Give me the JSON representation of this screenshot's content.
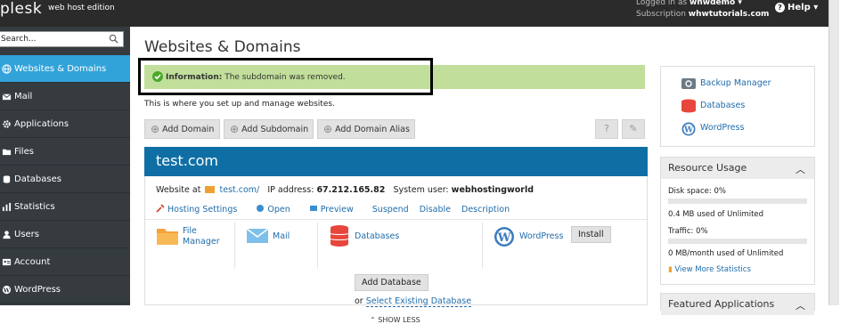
{
  "header": {
    "logo": "plesk",
    "edition": "web host edition",
    "logged_in_label": "Logged in as",
    "logged_in_user": "whwdemo",
    "subscription_label": "Subscription",
    "subscription_value": "whwtutorials.com",
    "help_label": "Help"
  },
  "sidebar": {
    "search_placeholder": "Search...",
    "items": [
      {
        "label": "Websites & Domains",
        "icon": "globe-icon",
        "active": true
      },
      {
        "label": "Mail",
        "icon": "mail-icon"
      },
      {
        "label": "Applications",
        "icon": "gear-icon"
      },
      {
        "label": "Files",
        "icon": "folder-icon"
      },
      {
        "label": "Databases",
        "icon": "database-icon"
      },
      {
        "label": "Statistics",
        "icon": "chart-icon"
      },
      {
        "label": "Users",
        "icon": "user-icon"
      },
      {
        "label": "Account",
        "icon": "account-icon"
      },
      {
        "label": "WordPress",
        "icon": "wordpress-icon"
      }
    ]
  },
  "main": {
    "title": "Websites & Domains",
    "info_label": "Information:",
    "info_text": "The subdomain was removed.",
    "intro": "This is where you set up and manage websites.",
    "toolbar": {
      "add_domain": "Add Domain",
      "add_subdomain": "Add Subdomain",
      "add_alias": "Add Domain Alias",
      "help": "?",
      "tools": "tools"
    },
    "domain": {
      "name": "test.com",
      "website_at": "Website at",
      "site_link": "test.com/",
      "ip_label": "IP address:",
      "ip": "67.212.165.82",
      "sysuser_label": "System user:",
      "sysuser": "webhostingworld",
      "actions": [
        "Hosting Settings",
        "Open",
        "Preview",
        "Suspend",
        "Disable",
        "Description"
      ],
      "file_manager_1": "File",
      "file_manager_2": "Manager",
      "mail": "Mail",
      "databases": "Databases",
      "add_database": "Add Database",
      "or": "or",
      "select_existing": "Select Existing Database",
      "wordpress": "WordPress",
      "install": "Install",
      "show_less": "SHOW LESS"
    }
  },
  "right": {
    "links": [
      "Backup Manager",
      "Databases",
      "WordPress"
    ],
    "resource_title": "Resource Usage",
    "disk_label": "Disk space: 0%",
    "disk_value": "0.4 MB used of Unlimited",
    "traffic_label": "Traffic: 0%",
    "traffic_value": "0 MB/month used of Unlimited",
    "more_stats": "View More Statistics",
    "featured_title": "Featured Applications",
    "disk_percent": 0,
    "traffic_percent": 0
  },
  "colors": {
    "topbar": "#2b2b2b",
    "sidebar": "#353b3f",
    "active": "#31a3d9",
    "info": "#c1df9a",
    "domain_header": "#0f6fa5",
    "link": "#1f6cab"
  }
}
